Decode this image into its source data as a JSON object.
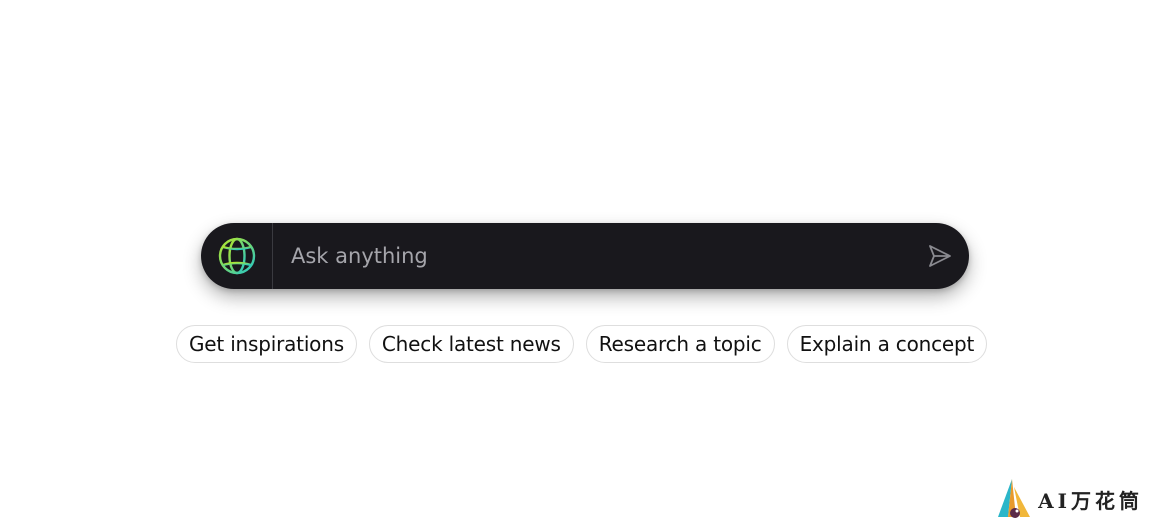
{
  "search": {
    "placeholder": "Ask anything",
    "globe_icon": "globe-icon",
    "send_icon": "send-icon"
  },
  "suggestions": [
    {
      "label": "Get inspirations"
    },
    {
      "label": "Check latest news"
    },
    {
      "label": "Research a topic"
    },
    {
      "label": "Explain a concept"
    }
  ],
  "watermark": {
    "text": "AI万花筒"
  },
  "colors": {
    "search_bg": "#19181d",
    "globe_gradient_start": "#a6e22e",
    "globe_gradient_end": "#2ec8c8",
    "placeholder": "#a5a5ab",
    "chip_border": "#dedede"
  }
}
